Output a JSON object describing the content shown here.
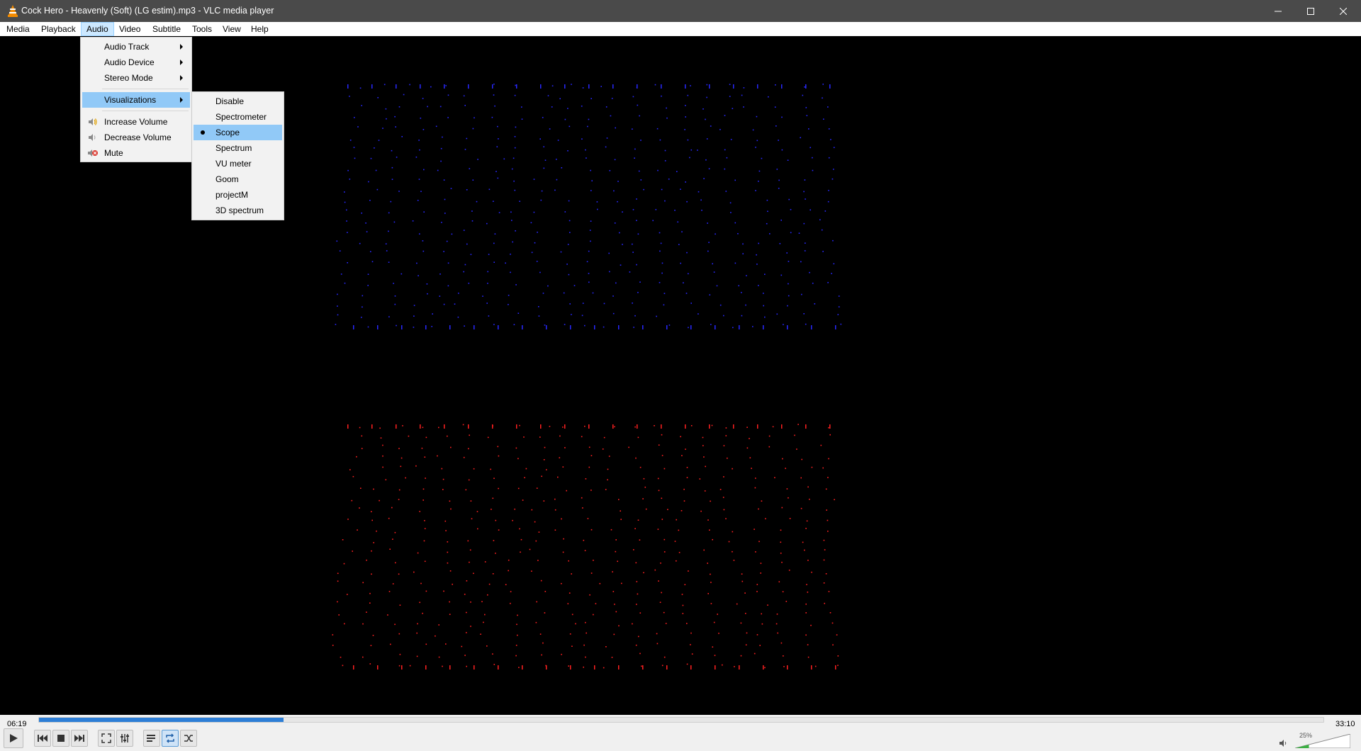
{
  "window": {
    "title": "Cock Hero - Heavenly (Soft) (LG estim).mp3 - VLC media player",
    "icons": [
      "vlc-cone-icon",
      "minimize-icon",
      "maximize-icon",
      "close-icon"
    ]
  },
  "menubar": {
    "items": [
      {
        "label": "Media"
      },
      {
        "label": "Playback"
      },
      {
        "label": "Audio",
        "active": true
      },
      {
        "label": "Video"
      },
      {
        "label": "Subtitle"
      },
      {
        "label": "Tools"
      },
      {
        "label": "View"
      },
      {
        "label": "Help"
      }
    ]
  },
  "audio_menu": {
    "items": [
      {
        "label": "Audio Track",
        "submenu": true
      },
      {
        "label": "Audio Device",
        "submenu": true
      },
      {
        "label": "Stereo Mode",
        "submenu": true
      },
      {
        "label": "Visualizations",
        "submenu": true,
        "highlighted": true
      },
      {
        "label": "Increase Volume",
        "icon": "volume-up-icon"
      },
      {
        "label": "Decrease Volume",
        "icon": "volume-down-icon"
      },
      {
        "label": "Mute",
        "icon": "mute-icon"
      }
    ]
  },
  "visualizations_menu": {
    "items": [
      {
        "label": "Disable"
      },
      {
        "label": "Spectrometer"
      },
      {
        "label": "Scope",
        "selected": true
      },
      {
        "label": "Spectrum"
      },
      {
        "label": "VU meter"
      },
      {
        "label": "Goom"
      },
      {
        "label": "projectM"
      },
      {
        "label": "3D spectrum"
      }
    ]
  },
  "visualization": {
    "type": "scope",
    "colors": {
      "left_channel": "#2828ff",
      "right_channel": "#ff2020"
    }
  },
  "playback": {
    "elapsed": "06:19",
    "total": "33:10",
    "progress": 0.1905
  },
  "volume": {
    "label": "25%",
    "level": 0.25
  },
  "controls": {
    "buttons": [
      {
        "name": "play-button",
        "icon": "play-icon"
      },
      {
        "name": "previous-button",
        "icon": "previous-icon"
      },
      {
        "name": "stop-button",
        "icon": "stop-icon"
      },
      {
        "name": "next-button",
        "icon": "next-icon"
      },
      {
        "name": "fullscreen-button",
        "icon": "fullscreen-icon"
      },
      {
        "name": "extended-settings-button",
        "icon": "equalizer-icon"
      },
      {
        "name": "playlist-button",
        "icon": "playlist-icon"
      },
      {
        "name": "loop-button",
        "icon": "loop-icon",
        "active": true
      },
      {
        "name": "random-button",
        "icon": "shuffle-icon"
      }
    ]
  }
}
